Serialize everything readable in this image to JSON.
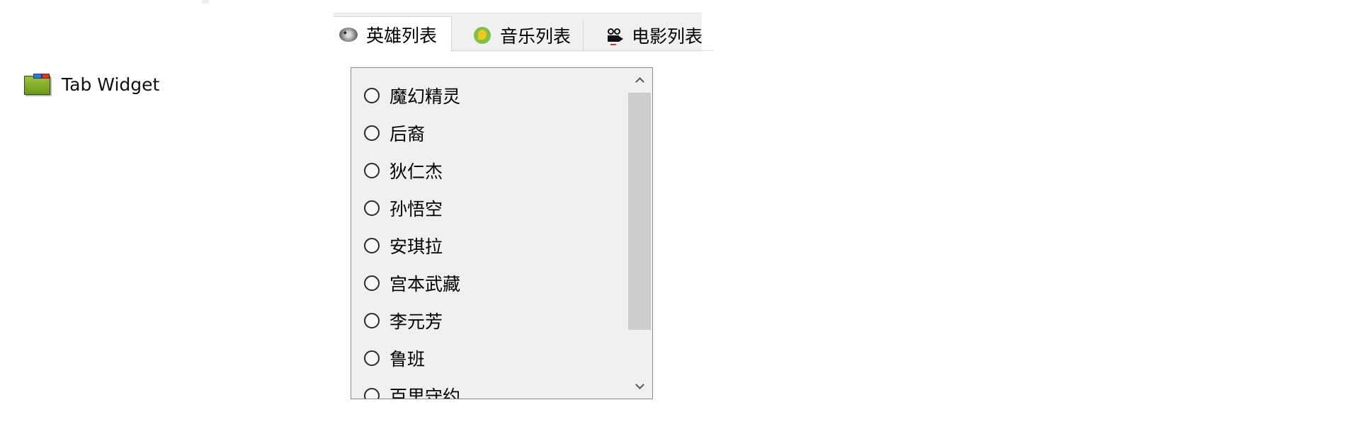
{
  "widget": {
    "icon": "tab-widget-icon",
    "label": "Tab Widget"
  },
  "tabs": [
    {
      "label": "英雄列表",
      "icon": "hero-icon",
      "active": true
    },
    {
      "label": "音乐列表",
      "icon": "music-icon",
      "active": false
    },
    {
      "label": "电影列表",
      "icon": "movie-icon",
      "active": false
    }
  ],
  "heroes": [
    "魔幻精灵",
    "后裔",
    "狄仁杰",
    "孙悟空",
    "安琪拉",
    "宫本武藏",
    "李元芳",
    "鲁班",
    "百里守约"
  ],
  "colors": {
    "tab_bar_bg": "#f0f0f0",
    "active_tab_bg": "#ffffff",
    "panel_bg": "#f0f0f0",
    "scroll_thumb": "#cdcdcd"
  }
}
